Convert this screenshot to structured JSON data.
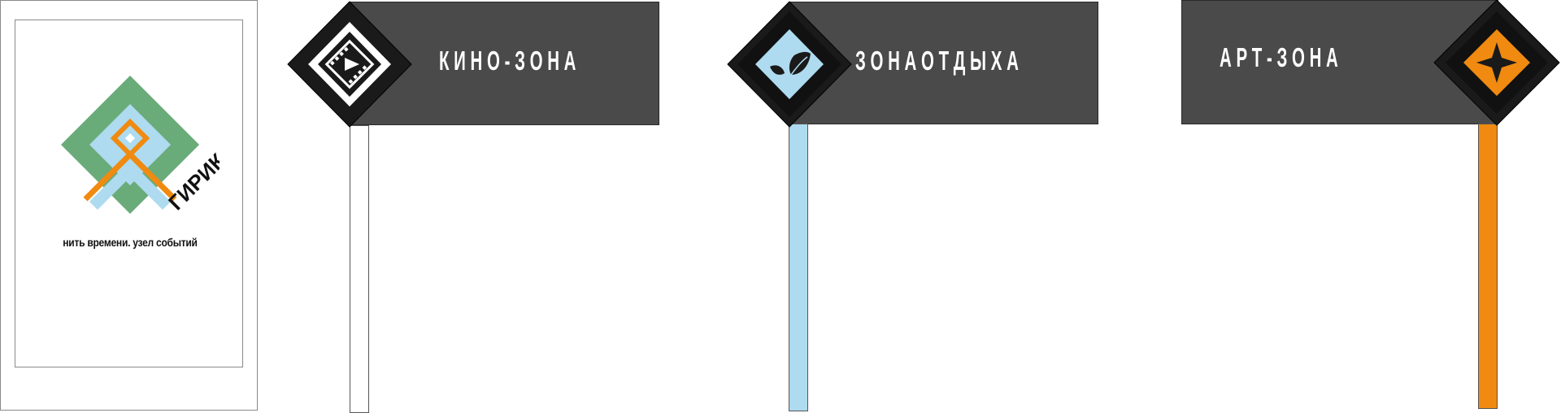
{
  "poster": {
    "brand": "ГИРИК",
    "tagline": "нить времени. узел событий"
  },
  "signs": [
    {
      "label": "К И Н О - З О Н А",
      "icon": "film-play-icon"
    },
    {
      "label": "З О Н А  О Т Д Ы Х А",
      "icon": "leaves-icon"
    },
    {
      "label": "А Р Т - З О Н А",
      "icon": "four-point-star-icon"
    }
  ],
  "colors": {
    "panel": "#4a4a4a",
    "diamond_dark": "#1a1a1a",
    "green": "#6aab7a",
    "light_blue": "#aedbef",
    "orange": "#f08a10",
    "post_white": "#ffffff"
  }
}
